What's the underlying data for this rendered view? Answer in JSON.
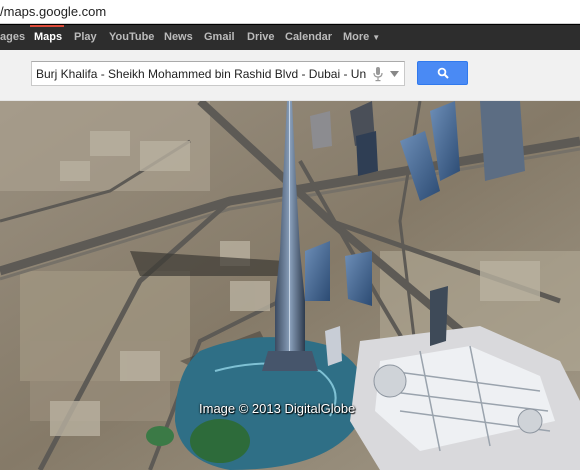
{
  "browser": {
    "url": "/maps.google.com"
  },
  "nav": {
    "items": [
      {
        "id": "images",
        "label": "ages",
        "active": false
      },
      {
        "id": "maps",
        "label": "Maps",
        "active": true
      },
      {
        "id": "play",
        "label": "Play",
        "active": false
      },
      {
        "id": "youtube",
        "label": "YouTube",
        "active": false
      },
      {
        "id": "news",
        "label": "News",
        "active": false
      },
      {
        "id": "gmail",
        "label": "Gmail",
        "active": false
      },
      {
        "id": "drive",
        "label": "Drive",
        "active": false
      },
      {
        "id": "calendar",
        "label": "Calendar",
        "active": false
      },
      {
        "id": "more",
        "label": "More",
        "active": false
      }
    ],
    "more_caret": "▼"
  },
  "search": {
    "value": "Burj Khalifa - Sheikh Mohammed bin Rashid Blvd - Dubai - United",
    "button_icon": "search-icon",
    "mic_icon": "microphone-icon",
    "dropdown_icon": "dropdown-arrow-icon"
  },
  "map": {
    "view": "3D satellite earth view",
    "attribution": "Image © 2013 DigitalGlobe"
  },
  "colors": {
    "nav_bg": "#2d2d2d",
    "nav_active": "#ffffff",
    "nav_text": "#bbbbbb",
    "search_button": "#4a8af4"
  }
}
